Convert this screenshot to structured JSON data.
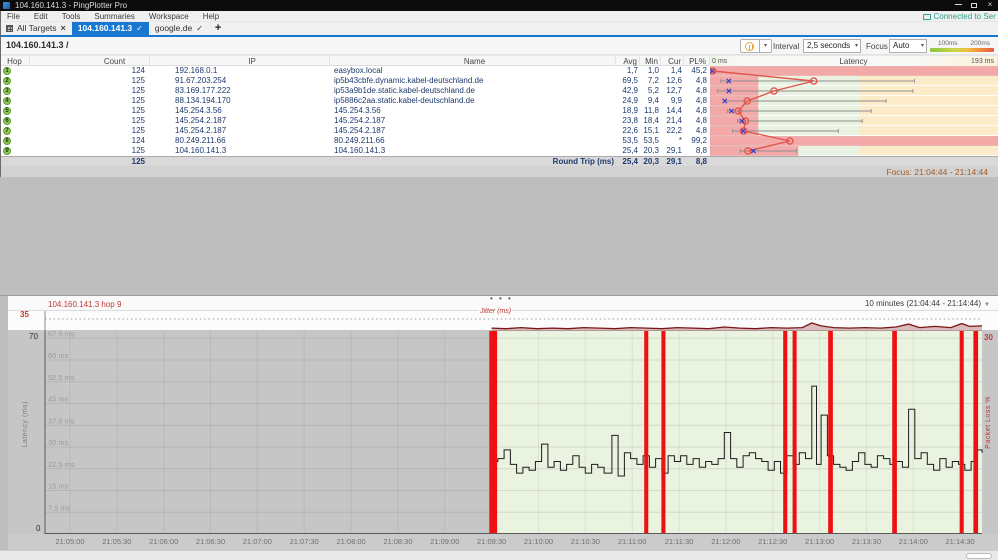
{
  "window": {
    "title": "104.160.141.3 - PingPlotter Pro",
    "controls": {
      "close": "×"
    }
  },
  "menu": {
    "items": [
      "File",
      "Edit",
      "Tools",
      "Summaries",
      "Workspace",
      "Help"
    ],
    "connected": "Connected to Ser"
  },
  "tabs": {
    "items": [
      {
        "label": "All Targets",
        "icon": "grid",
        "close": "×",
        "active": false
      },
      {
        "label": "104.160.141.3",
        "check": "✓",
        "active": true
      },
      {
        "label": "google.de",
        "check": "✓",
        "active": false
      }
    ],
    "new_tab": "+"
  },
  "target": {
    "title": "104.160.141.3 /",
    "interval_label": "Interval",
    "interval_value": "2,5 seconds",
    "focus_label": "Focus",
    "focus_value": "Auto",
    "legend": {
      "left": "100ms",
      "right": "200ms"
    }
  },
  "table": {
    "headers": {
      "hop": "Hop",
      "count": "Count",
      "ip": "IP",
      "name": "Name",
      "avg": "Avg",
      "min": "Min",
      "cur": "Cur",
      "pl": "PL%",
      "latency": "Latency",
      "lat_left": "0 ms",
      "lat_right": "193 ms"
    },
    "rows": [
      {
        "hop": "1",
        "count": "124",
        "ip": "192.168.0.1",
        "name": "easybox.local",
        "avg": "1,7",
        "min": "1,0",
        "cur": "1,4",
        "pl": "45,2"
      },
      {
        "hop": "2",
        "count": "125",
        "ip": "91.67.203.254",
        "name": "ip5b43cbfe.dynamic.kabel-deutschland.de",
        "avg": "69,5",
        "min": "7,2",
        "cur": "12,6",
        "pl": "4,8"
      },
      {
        "hop": "3",
        "count": "125",
        "ip": "83.169.177.222",
        "name": "ip53a9b1de.static.kabel-deutschland.de",
        "avg": "42,9",
        "min": "5,2",
        "cur": "12,7",
        "pl": "4,8"
      },
      {
        "hop": "4",
        "count": "125",
        "ip": "88.134.194.170",
        "name": "ip5886c2aa.static.kabel-deutschland.de",
        "avg": "24,9",
        "min": "9,4",
        "cur": "9,9",
        "pl": "4,8"
      },
      {
        "hop": "5",
        "count": "125",
        "ip": "145.254.3.56",
        "name": "145.254.3.56",
        "avg": "18,9",
        "min": "11,8",
        "cur": "14,4",
        "pl": "4,8"
      },
      {
        "hop": "6",
        "count": "125",
        "ip": "145.254.2.187",
        "name": "145.254.2.187",
        "avg": "23,8",
        "min": "18,4",
        "cur": "21,4",
        "pl": "4,8"
      },
      {
        "hop": "7",
        "count": "125",
        "ip": "145.254.2.187",
        "name": "145.254.2.187",
        "avg": "22,6",
        "min": "15,1",
        "cur": "22,2",
        "pl": "4,8"
      },
      {
        "hop": "8",
        "count": "124",
        "ip": "80.249.211.66",
        "name": "80.249.211.66",
        "avg": "53,5",
        "min": "53,5",
        "cur": "*",
        "pl": "99,2"
      },
      {
        "hop": "9",
        "count": "125",
        "ip": "104.160.141.3",
        "name": "104.160.141.3",
        "avg": "25,4",
        "min": "20,3",
        "cur": "29,1",
        "pl": "8,8",
        "graph_icon": true
      }
    ],
    "summary": {
      "count": "125",
      "label": "Round Trip (ms)",
      "avg": "25,4",
      "min": "20,3",
      "cur": "29,1",
      "pl": "8,8"
    }
  },
  "focus_bar": "Focus: 21:04:44 - 21:14:44",
  "bottom": {
    "trace_label": "104.160.141.3 hop 9",
    "range_label": "10 minutes (21:04:44 - 21:14:44)",
    "jitter_label": "Jitter (ms)",
    "jitter_max": "35",
    "lat_max": "70",
    "lat_min": "0",
    "pl_max": "30",
    "ylabel": "Latency (ms)",
    "y2label": "Packet Loss %",
    "grid_labels": [
      {
        "v": 67.5,
        "label": "67,5 ms"
      },
      {
        "v": 60,
        "label": "60 ms"
      },
      {
        "v": 52.5,
        "label": "52,5 ms"
      },
      {
        "v": 45,
        "label": "45 ms"
      },
      {
        "v": 37.5,
        "label": "37,5 ms"
      },
      {
        "v": 30,
        "label": "30 ms"
      },
      {
        "v": 22.5,
        "label": "22,5 ms"
      },
      {
        "v": 15,
        "label": "15 ms"
      },
      {
        "v": 7.5,
        "label": "7,5 ms"
      }
    ]
  },
  "chart_data": [
    {
      "type": "scatter",
      "title": "Per-hop latency (avg circle, current x, min-max whisker, loss bar)",
      "x_unit": "ms",
      "x_range": [
        0,
        193
      ],
      "green_zone_max_ms": 100,
      "hops": [
        {
          "hop": 1,
          "avg": 1.7,
          "min": 1.0,
          "cur": 1.4,
          "loss_pct": 45.2,
          "max_est": 4
        },
        {
          "hop": 2,
          "avg": 69.5,
          "min": 7.2,
          "cur": 12.6,
          "loss_pct": 4.8,
          "max_est": 137
        },
        {
          "hop": 3,
          "avg": 42.9,
          "min": 5.2,
          "cur": 12.7,
          "loss_pct": 4.8,
          "max_est": 136
        },
        {
          "hop": 4,
          "avg": 24.9,
          "min": 9.4,
          "cur": 9.9,
          "loss_pct": 4.8,
          "max_est": 118
        },
        {
          "hop": 5,
          "avg": 18.9,
          "min": 11.8,
          "cur": 14.4,
          "loss_pct": 4.8,
          "max_est": 108
        },
        {
          "hop": 6,
          "avg": 23.8,
          "min": 18.4,
          "cur": 21.4,
          "loss_pct": 4.8,
          "max_est": 102
        },
        {
          "hop": 7,
          "avg": 22.6,
          "min": 15.1,
          "cur": 22.2,
          "loss_pct": 4.8,
          "max_est": 86
        },
        {
          "hop": 8,
          "avg": 53.5,
          "min": 53.5,
          "cur": null,
          "loss_pct": 99.2,
          "max_est": null
        },
        {
          "hop": 9,
          "avg": 25.4,
          "min": 20.3,
          "cur": 29.1,
          "loss_pct": 8.8,
          "max_est": 58
        }
      ]
    },
    {
      "type": "line",
      "title": "104.160.141.3 hop 9",
      "window_label": "10 minutes (21:04:44 - 21:14:44)",
      "start_time": "21:04:44",
      "end_time": "21:14:44",
      "duration_s": 600,
      "ylabel": "Latency (ms)",
      "ylim": [
        0,
        70
      ],
      "y2label": "Packet Loss %",
      "y2lim": [
        0,
        30
      ],
      "jitter_ylim": [
        0,
        35
      ],
      "data_start_s": 286,
      "x_ticks": [
        {
          "s": 16,
          "label": "21:05:00"
        },
        {
          "s": 46,
          "label": "21:05:30"
        },
        {
          "s": 76,
          "label": "21:06:00"
        },
        {
          "s": 106,
          "label": "21:06:30"
        },
        {
          "s": 136,
          "label": "21:07:00"
        },
        {
          "s": 166,
          "label": "21:07:30"
        },
        {
          "s": 196,
          "label": "21:08:00"
        },
        {
          "s": 226,
          "label": "21:08:30"
        },
        {
          "s": 256,
          "label": "21:09:00"
        },
        {
          "s": 286,
          "label": "21:09:30"
        },
        {
          "s": 316,
          "label": "21:10:00"
        },
        {
          "s": 346,
          "label": "21:10:30"
        },
        {
          "s": 376,
          "label": "21:11:00"
        },
        {
          "s": 406,
          "label": "21:11:30"
        },
        {
          "s": 436,
          "label": "21:12:00"
        },
        {
          "s": 466,
          "label": "21:12:30"
        },
        {
          "s": 496,
          "label": "21:13:00"
        },
        {
          "s": 526,
          "label": "21:13:30"
        },
        {
          "s": 556,
          "label": "21:14:00"
        },
        {
          "s": 586,
          "label": "21:14:30"
        }
      ],
      "latency_ms": [
        [
          286,
          25
        ],
        [
          290,
          26
        ],
        [
          294,
          29
        ],
        [
          298,
          24
        ],
        [
          302,
          21
        ],
        [
          306,
          23
        ],
        [
          310,
          22
        ],
        [
          314,
          25
        ],
        [
          318,
          31
        ],
        [
          322,
          23
        ],
        [
          326,
          25
        ],
        [
          330,
          22
        ],
        [
          334,
          24
        ],
        [
          338,
          27
        ],
        [
          342,
          23
        ],
        [
          346,
          21
        ],
        [
          350,
          24
        ],
        [
          354,
          23
        ],
        [
          358,
          21
        ],
        [
          363,
          34
        ],
        [
          367,
          20
        ],
        [
          371,
          28
        ],
        [
          375,
          26
        ],
        [
          379,
          24
        ],
        [
          383,
          27
        ],
        [
          387,
          23
        ],
        [
          391,
          26
        ],
        [
          395,
          21
        ],
        [
          399,
          27
        ],
        [
          403,
          25
        ],
        [
          407,
          27
        ],
        [
          411,
          24
        ],
        [
          415,
          26
        ],
        [
          419,
          23
        ],
        [
          423,
          25
        ],
        [
          427,
          24
        ],
        [
          431,
          26
        ],
        [
          435,
          35
        ],
        [
          439,
          26
        ],
        [
          443,
          23
        ],
        [
          447,
          27
        ],
        [
          451,
          28
        ],
        [
          455,
          26
        ],
        [
          459,
          25
        ],
        [
          463,
          22
        ],
        [
          467,
          25
        ],
        [
          471,
          21
        ],
        [
          475,
          27
        ],
        [
          479,
          24
        ],
        [
          483,
          28
        ],
        [
          487,
          26
        ],
        [
          491,
          51
        ],
        [
          494,
          24
        ],
        [
          497,
          41
        ],
        [
          501,
          27
        ],
        [
          505,
          24
        ],
        [
          509,
          23
        ],
        [
          513,
          22
        ],
        [
          517,
          25
        ],
        [
          521,
          28
        ],
        [
          525,
          24
        ],
        [
          529,
          23
        ],
        [
          533,
          27
        ],
        [
          537,
          26
        ],
        [
          541,
          24
        ],
        [
          545,
          25
        ],
        [
          549,
          23
        ],
        [
          553,
          43
        ],
        [
          557,
          26
        ],
        [
          561,
          28
        ],
        [
          565,
          24
        ],
        [
          569,
          22
        ],
        [
          573,
          26
        ],
        [
          577,
          23
        ],
        [
          581,
          25
        ],
        [
          585,
          24
        ],
        [
          589,
          22
        ],
        [
          593,
          25
        ],
        [
          597,
          29
        ],
        [
          600,
          28
        ]
      ],
      "packet_loss_events": [
        {
          "s": 287,
          "width_s": 5
        },
        {
          "s": 385,
          "width_s": 2.6
        },
        {
          "s": 396,
          "width_s": 2.6
        },
        {
          "s": 474,
          "width_s": 2.6
        },
        {
          "s": 480,
          "width_s": 2.6
        },
        {
          "s": 503,
          "width_s": 3
        },
        {
          "s": 544,
          "width_s": 3
        },
        {
          "s": 587,
          "width_s": 2.6
        },
        {
          "s": 596,
          "width_s": 3
        }
      ],
      "jitter": [
        [
          286,
          5
        ],
        [
          295,
          4
        ],
        [
          305,
          6
        ],
        [
          315,
          4
        ],
        [
          325,
          5
        ],
        [
          335,
          4
        ],
        [
          345,
          6
        ],
        [
          355,
          5
        ],
        [
          365,
          4
        ],
        [
          375,
          6
        ],
        [
          385,
          5
        ],
        [
          395,
          4
        ],
        [
          405,
          6
        ],
        [
          415,
          5
        ],
        [
          425,
          4
        ],
        [
          435,
          7
        ],
        [
          445,
          5
        ],
        [
          455,
          4
        ],
        [
          465,
          6
        ],
        [
          475,
          5
        ],
        [
          485,
          6
        ],
        [
          491,
          14
        ],
        [
          497,
          9
        ],
        [
          505,
          6
        ],
        [
          515,
          5
        ],
        [
          525,
          6
        ],
        [
          535,
          5
        ],
        [
          545,
          7
        ],
        [
          553,
          12
        ],
        [
          560,
          6
        ],
        [
          570,
          8
        ],
        [
          580,
          6
        ],
        [
          587,
          13
        ],
        [
          592,
          8
        ],
        [
          600,
          9
        ]
      ]
    }
  ],
  "colors": {
    "accent_blue": "#1878d0",
    "pause_orange": "#f0a030",
    "hop_green": "#8fc857",
    "latency_green_zone": "#eaf3e1",
    "latency_amber_zone": "#fcebc9",
    "loss_pink": "#f4a9a9",
    "line_red": "#e2554d",
    "marker_blue": "#3b3bd1",
    "packet_loss_red": "#ee1111",
    "timeline_green": "#e9f3e0",
    "connected_teal": "#2aa18a"
  }
}
